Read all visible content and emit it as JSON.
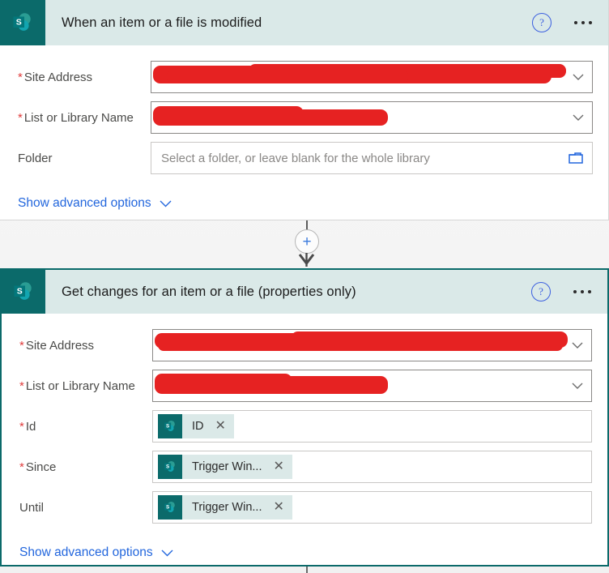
{
  "cards": [
    {
      "id": "trigger-card",
      "title": "When an item or a file is modified",
      "icon": "sharepoint-icon",
      "help_icon": "help-circle-icon",
      "overflow_icon": "ellipsis-icon",
      "selected": false,
      "rows": [
        {
          "label": "Site Address",
          "required": true,
          "type": "dropdown",
          "value": "",
          "redacted": true,
          "trailing_icon": "chevron-down-icon"
        },
        {
          "label": "List or Library Name",
          "required": true,
          "type": "dropdown",
          "value": "",
          "redacted": true,
          "trailing_icon": "chevron-down-icon"
        },
        {
          "label": "Folder",
          "required": false,
          "type": "picker",
          "value": "",
          "placeholder": "Select a folder, or leave blank for the whole library",
          "redacted": false,
          "trailing_icon": "folder-icon"
        }
      ],
      "advanced_label": "Show advanced options",
      "advanced_icon": "chevron-down-icon"
    },
    {
      "id": "action-card",
      "title": "Get changes for an item or a file (properties only)",
      "icon": "sharepoint-icon",
      "help_icon": "help-circle-icon",
      "overflow_icon": "ellipsis-icon",
      "selected": true,
      "rows": [
        {
          "label": "Site Address",
          "required": true,
          "type": "dropdown",
          "value": "",
          "redacted": true,
          "trailing_icon": "chevron-down-icon"
        },
        {
          "label": "List or Library Name",
          "required": true,
          "type": "dropdown",
          "value": "",
          "redacted": true,
          "trailing_icon": "chevron-down-icon"
        },
        {
          "label": "Id",
          "required": true,
          "type": "token",
          "token": {
            "label": "ID",
            "icon": "sharepoint-icon",
            "remove_icon": "close-icon"
          }
        },
        {
          "label": "Since",
          "required": true,
          "type": "token",
          "token": {
            "label": "Trigger Win...",
            "icon": "sharepoint-icon",
            "remove_icon": "close-icon"
          }
        },
        {
          "label": "Until",
          "required": false,
          "type": "token",
          "token": {
            "label": "Trigger Win...",
            "icon": "sharepoint-icon",
            "remove_icon": "close-icon"
          }
        }
      ],
      "advanced_label": "Show advanced options",
      "advanced_icon": "chevron-down-icon"
    }
  ],
  "connector": {
    "add_label": "+",
    "add_icon": "plus-icon",
    "arrow_icon": "arrow-down-icon"
  },
  "colors": {
    "brand_teal": "#0b6a6a",
    "header_bg": "#dae9e8",
    "selected_border": "#0b6a6a",
    "redaction": "#e62222",
    "link_blue": "#2266dd",
    "required_red": "#e03b3b"
  }
}
